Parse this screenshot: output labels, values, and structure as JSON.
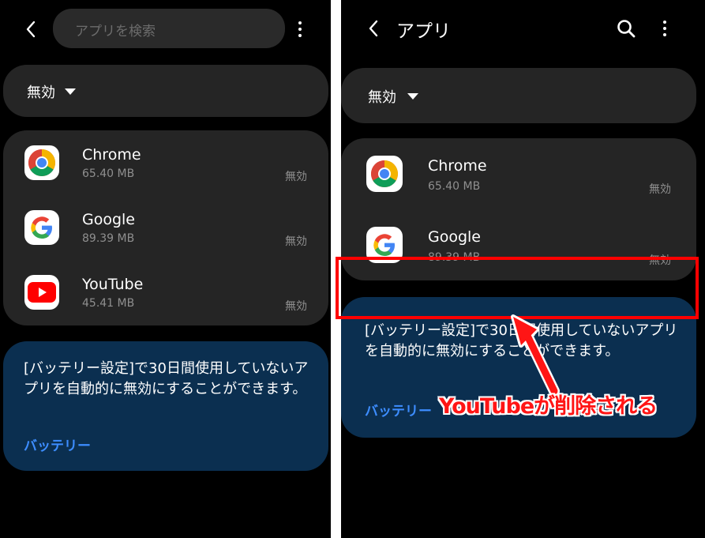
{
  "left": {
    "search_placeholder": "アプリを検索",
    "filter_label": "無効",
    "apps": [
      {
        "name": "Chrome",
        "size": "65.40 MB",
        "status": "無効",
        "icon": "chrome-icon"
      },
      {
        "name": "Google",
        "size": "89.39 MB",
        "status": "無効",
        "icon": "google-icon"
      },
      {
        "name": "YouTube",
        "size": "45.41 MB",
        "status": "無効",
        "icon": "youtube-icon"
      }
    ],
    "info_text": "[バッテリー設定]で30日間使用していないアプリを自動的に無効にすることができます。",
    "info_link": "バッテリー"
  },
  "right": {
    "title": "アプリ",
    "filter_label": "無効",
    "apps": [
      {
        "name": "Chrome",
        "size": "65.40 MB",
        "status": "無効",
        "icon": "chrome-icon"
      },
      {
        "name": "Google",
        "size": "89.39 MB",
        "status": "無効",
        "icon": "google-icon"
      }
    ],
    "info_text": "[バッテリー設定]で30日間使用していないアプリを自動的に無効にすることができます。",
    "info_link": "バッテリー"
  },
  "annotation": {
    "text": "YouTubeが削除される",
    "color": "#ff1515"
  },
  "colors": {
    "background": "#000000",
    "card": "#252525",
    "info_card": "#0b2f50",
    "link": "#3d8dff",
    "highlight": "#ff0000"
  }
}
